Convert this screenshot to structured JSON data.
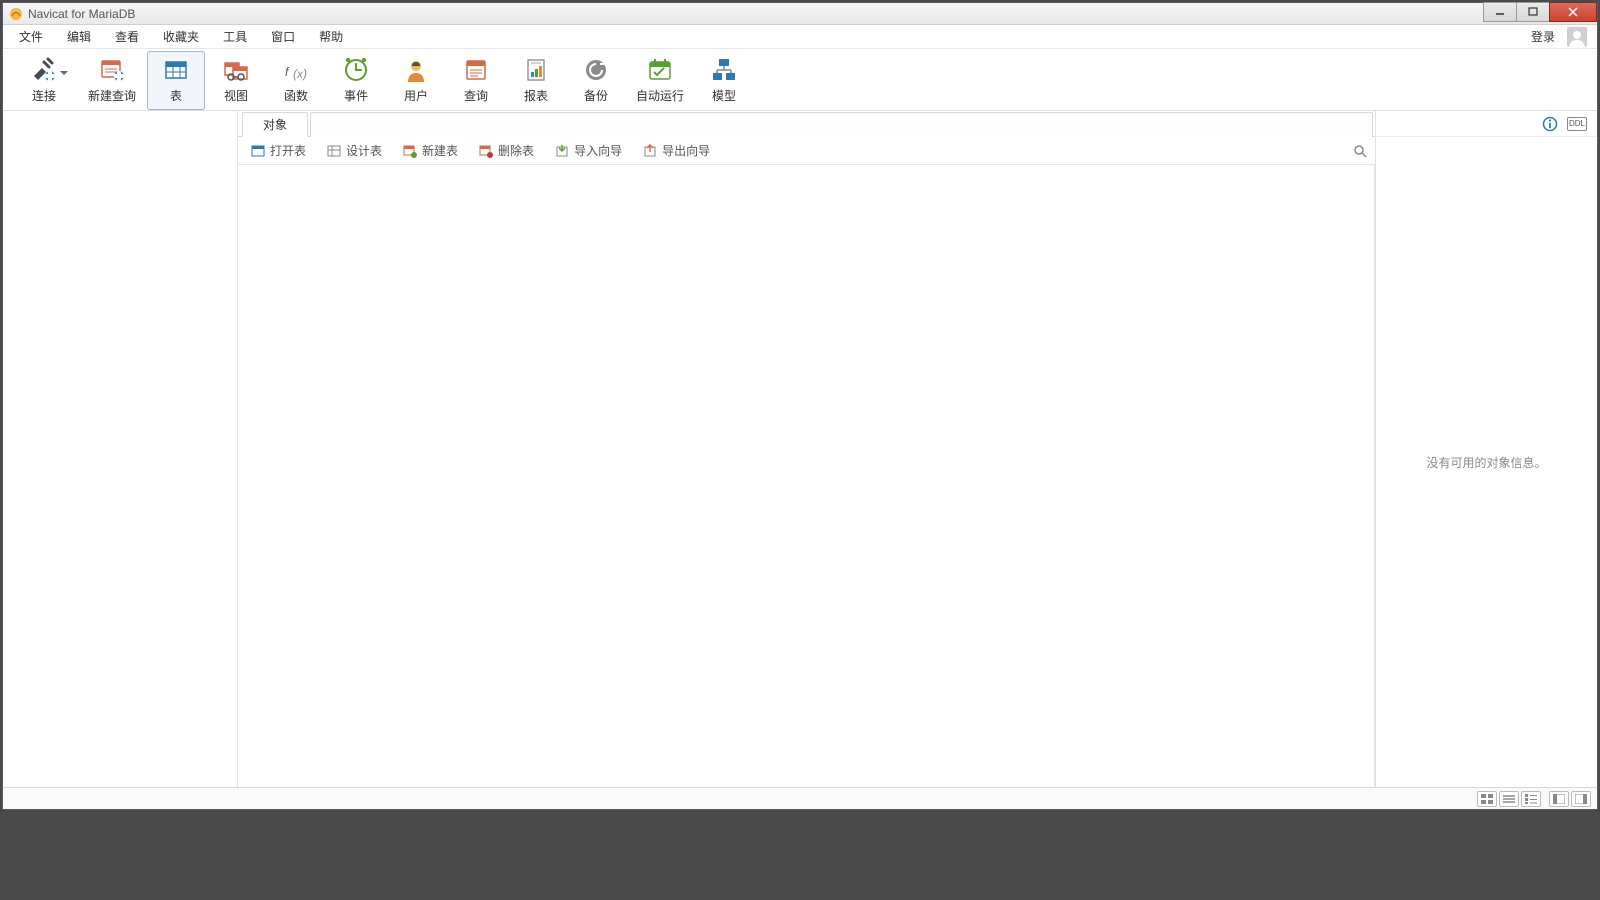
{
  "title": "Navicat for MariaDB",
  "menubar": {
    "items": [
      "文件",
      "编辑",
      "查看",
      "收藏夹",
      "工具",
      "窗口",
      "帮助"
    ],
    "login": "登录"
  },
  "toolbar": {
    "items": [
      {
        "key": "connect",
        "label": "连接",
        "hasDropdown": true
      },
      {
        "key": "newquery",
        "label": "新建查询"
      },
      {
        "key": "table",
        "label": "表",
        "active": true
      },
      {
        "key": "view",
        "label": "视图"
      },
      {
        "key": "function",
        "label": "函数"
      },
      {
        "key": "event",
        "label": "事件"
      },
      {
        "key": "user",
        "label": "用户"
      },
      {
        "key": "query",
        "label": "查询"
      },
      {
        "key": "report",
        "label": "报表"
      },
      {
        "key": "backup",
        "label": "备份"
      },
      {
        "key": "autorun",
        "label": "自动运行"
      },
      {
        "key": "model",
        "label": "模型"
      }
    ]
  },
  "tabs": {
    "object": "对象"
  },
  "obj_toolbar": {
    "open": "打开表",
    "design": "设计表",
    "new": "新建表",
    "delete": "删除表",
    "import": "导入向导",
    "export": "导出向导"
  },
  "info_panel": {
    "empty": "没有可用的对象信息。"
  }
}
